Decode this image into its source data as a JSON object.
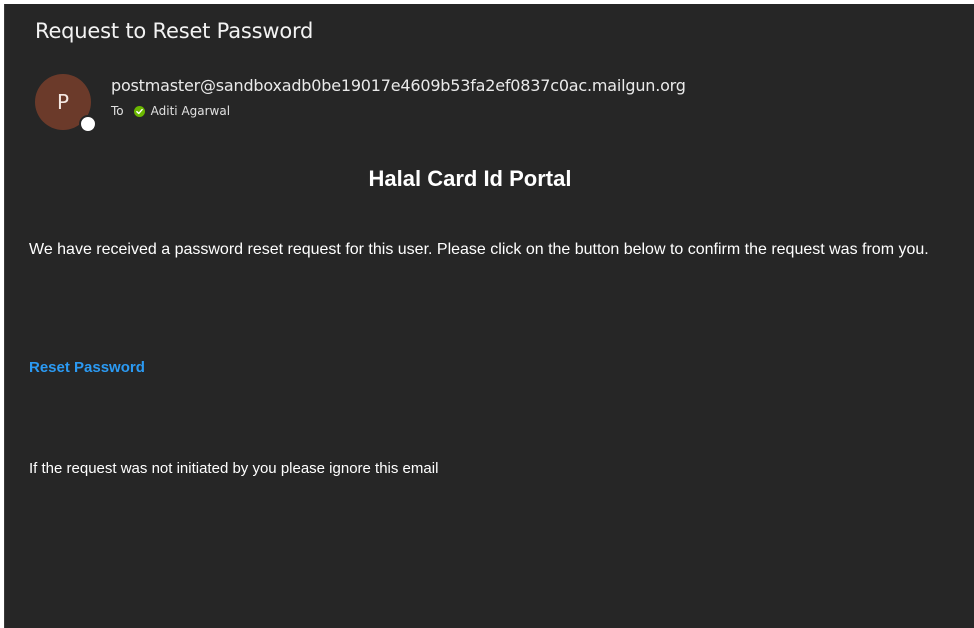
{
  "email": {
    "subject": "Request to Reset Password",
    "sender": {
      "avatar_initial": "P",
      "address": "postmaster@sandboxadb0be19017e4609b53fa2ef0837c0ac.mailgun.org",
      "avatar_color": "#6b3a2a",
      "presence_icon": "presence-dot-icon"
    },
    "recipient": {
      "prefix": "To",
      "name": "Aditi Agarwal",
      "status_icon": "check-circle-icon",
      "status_color": "#6bb700"
    }
  },
  "message": {
    "heading": "Halal Card Id Portal",
    "paragraph": "We have received a password reset request for this user. Please click on the button below to confirm the request was from you.",
    "reset_link_label": "Reset Password",
    "link_color": "#2b9af3",
    "footer_note": "If the request was not initiated by you please ignore this email"
  },
  "theme": {
    "background": "#262626",
    "text": "#ffffff"
  }
}
